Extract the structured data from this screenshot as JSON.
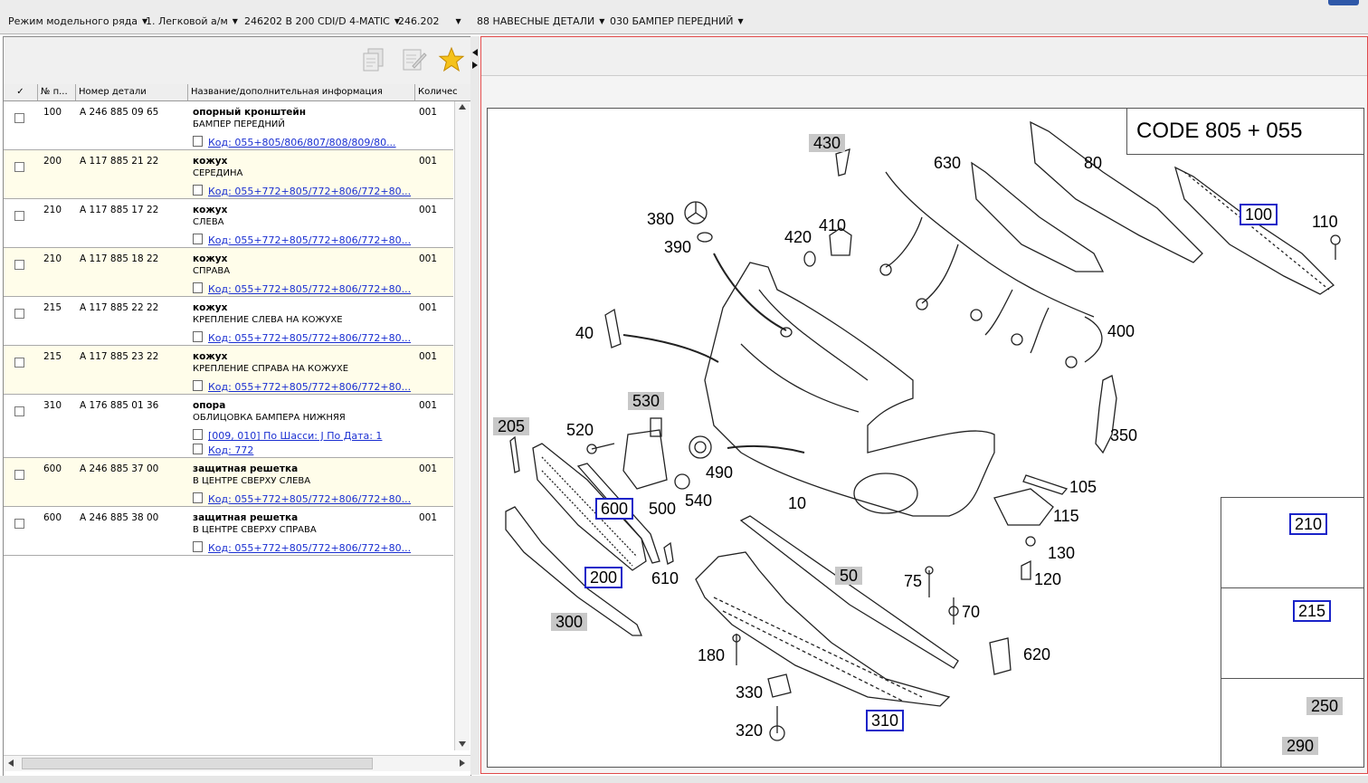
{
  "breadcrumbs": [
    {
      "label": "Режим модельного ряда"
    },
    {
      "label": "1. Легковой а/м"
    },
    {
      "label": "246202 B 200 CDI/D 4-MATIC"
    },
    {
      "label": "246.202"
    },
    {
      "label": "88 НАВЕСНЫЕ ДЕТАЛИ"
    },
    {
      "label": "030 БАМПЕР ПЕРЕДНИЙ"
    }
  ],
  "toolbar": {
    "icons": [
      "copy-icon",
      "edit-list-icon",
      "favorite-star-icon"
    ]
  },
  "table": {
    "headers": {
      "check": "✓",
      "pos": "№ п...",
      "part": "Номер детали",
      "name": "Название/дополнительная информация",
      "qty": "Количес"
    },
    "rows": [
      {
        "pos": "100",
        "part": "A 246 885 09 65",
        "name": "опорный кронштейн",
        "desc": "БАМПЕР ПЕРЕДНИЙ",
        "qty": "001",
        "links": [
          "Код: 055+805/806/807/808/809/80..."
        ]
      },
      {
        "pos": "200",
        "part": "A 117 885 21 22",
        "name": "кожух",
        "desc": "СЕРЕДИНА",
        "qty": "001",
        "links": [
          "Код: 055+772+805/772+806/772+80..."
        ]
      },
      {
        "pos": "210",
        "part": "A 117 885 17 22",
        "name": "кожух",
        "desc": "СЛЕВА",
        "qty": "001",
        "links": [
          "Код: 055+772+805/772+806/772+80..."
        ]
      },
      {
        "pos": "210",
        "part": "A 117 885 18 22",
        "name": "кожух",
        "desc": "СПРАВА",
        "qty": "001",
        "links": [
          "Код: 055+772+805/772+806/772+80..."
        ]
      },
      {
        "pos": "215",
        "part": "A 117 885 22 22",
        "name": "кожух",
        "desc": "КРЕПЛЕНИЕ СЛЕВА НА КОЖУХЕ",
        "qty": "001",
        "links": [
          "Код: 055+772+805/772+806/772+80..."
        ]
      },
      {
        "pos": "215",
        "part": "A 117 885 23 22",
        "name": "кожух",
        "desc": "КРЕПЛЕНИЕ СПРАВА НА КОЖУХЕ",
        "qty": "001",
        "links": [
          "Код: 055+772+805/772+806/772+80..."
        ]
      },
      {
        "pos": "310",
        "part": "A 176 885 01 36",
        "name": "опора",
        "desc": "ОБЛИЦОВКА БАМПЕРА НИЖНЯЯ",
        "qty": "001",
        "links": [
          "[009, 010] По Шасси: J По Дата: 1",
          "Код: 772"
        ]
      },
      {
        "pos": "600",
        "part": "A 246 885 37 00",
        "name": "защитная решетка",
        "desc": "В ЦЕНТРЕ СВЕРХУ СЛЕВА",
        "qty": "001",
        "links": [
          "Код: 055+772+805/772+806/772+80..."
        ]
      },
      {
        "pos": "600",
        "part": "A 246 885 38 00",
        "name": "защитная решетка",
        "desc": "В ЦЕНТРЕ СВЕРХУ СПРАВА",
        "qty": "001",
        "links": [
          "Код: 055+772+805/772+806/772+80..."
        ]
      }
    ]
  },
  "diagram": {
    "code_label": "CODE 805 + 055",
    "callouts": [
      {
        "label": "430",
        "style": "gray"
      },
      {
        "label": "630",
        "style": "plain"
      },
      {
        "label": "80",
        "style": "plain"
      },
      {
        "label": "100",
        "style": "blue"
      },
      {
        "label": "110",
        "style": "plain"
      },
      {
        "label": "380",
        "style": "plain"
      },
      {
        "label": "390",
        "style": "plain"
      },
      {
        "label": "420",
        "style": "plain"
      },
      {
        "label": "410",
        "style": "plain"
      },
      {
        "label": "40",
        "style": "plain"
      },
      {
        "label": "400",
        "style": "plain"
      },
      {
        "label": "530",
        "style": "gray"
      },
      {
        "label": "205",
        "style": "gray"
      },
      {
        "label": "520",
        "style": "plain"
      },
      {
        "label": "350",
        "style": "plain"
      },
      {
        "label": "490",
        "style": "plain"
      },
      {
        "label": "600",
        "style": "blue"
      },
      {
        "label": "500",
        "style": "plain"
      },
      {
        "label": "540",
        "style": "plain"
      },
      {
        "label": "10",
        "style": "plain"
      },
      {
        "label": "105",
        "style": "plain"
      },
      {
        "label": "115",
        "style": "plain"
      },
      {
        "label": "200",
        "style": "blue"
      },
      {
        "label": "610",
        "style": "plain"
      },
      {
        "label": "50",
        "style": "gray"
      },
      {
        "label": "130",
        "style": "plain"
      },
      {
        "label": "75",
        "style": "plain"
      },
      {
        "label": "120",
        "style": "plain"
      },
      {
        "label": "300",
        "style": "gray"
      },
      {
        "label": "70",
        "style": "plain"
      },
      {
        "label": "180",
        "style": "plain"
      },
      {
        "label": "620",
        "style": "plain"
      },
      {
        "label": "330",
        "style": "plain"
      },
      {
        "label": "310",
        "style": "blue"
      },
      {
        "label": "320",
        "style": "plain"
      },
      {
        "label": "210",
        "style": "blue"
      },
      {
        "label": "215",
        "style": "blue"
      },
      {
        "label": "250",
        "style": "gray"
      },
      {
        "label": "290",
        "style": "gray"
      }
    ]
  }
}
